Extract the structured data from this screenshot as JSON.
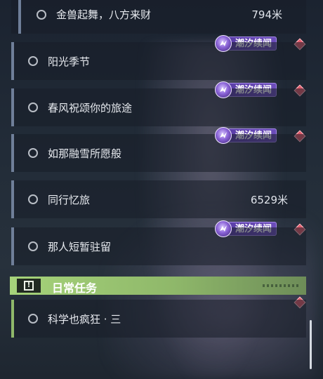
{
  "quests": [
    {
      "label": "金兽起舞，八方来财",
      "distance": "794米",
      "tag": null
    },
    {
      "label": "阳光季节",
      "distance": null,
      "tag": "潮汐续闻"
    },
    {
      "label": "春风祝颂你的旅途",
      "distance": null,
      "tag": "潮汐续闻"
    },
    {
      "label": "如那融雪所愿般",
      "distance": null,
      "tag": "潮汐续闻"
    },
    {
      "label": "同行忆旅",
      "distance": "6529米",
      "tag": null
    },
    {
      "label": "那人短暂驻留",
      "distance": null,
      "tag": "潮汐续闻"
    }
  ],
  "daily_section": {
    "title": "日常任务",
    "icon": "exclamation-box-icon",
    "accent": "#a6d37a"
  },
  "daily_quests": [
    {
      "label": "科学也疯狂 · 三",
      "distance": null,
      "tag": null
    }
  ],
  "colors": {
    "tag_purple": "#6c4dbb",
    "marker_red": "#e25c6c",
    "row_bar": "#6f7f99"
  }
}
